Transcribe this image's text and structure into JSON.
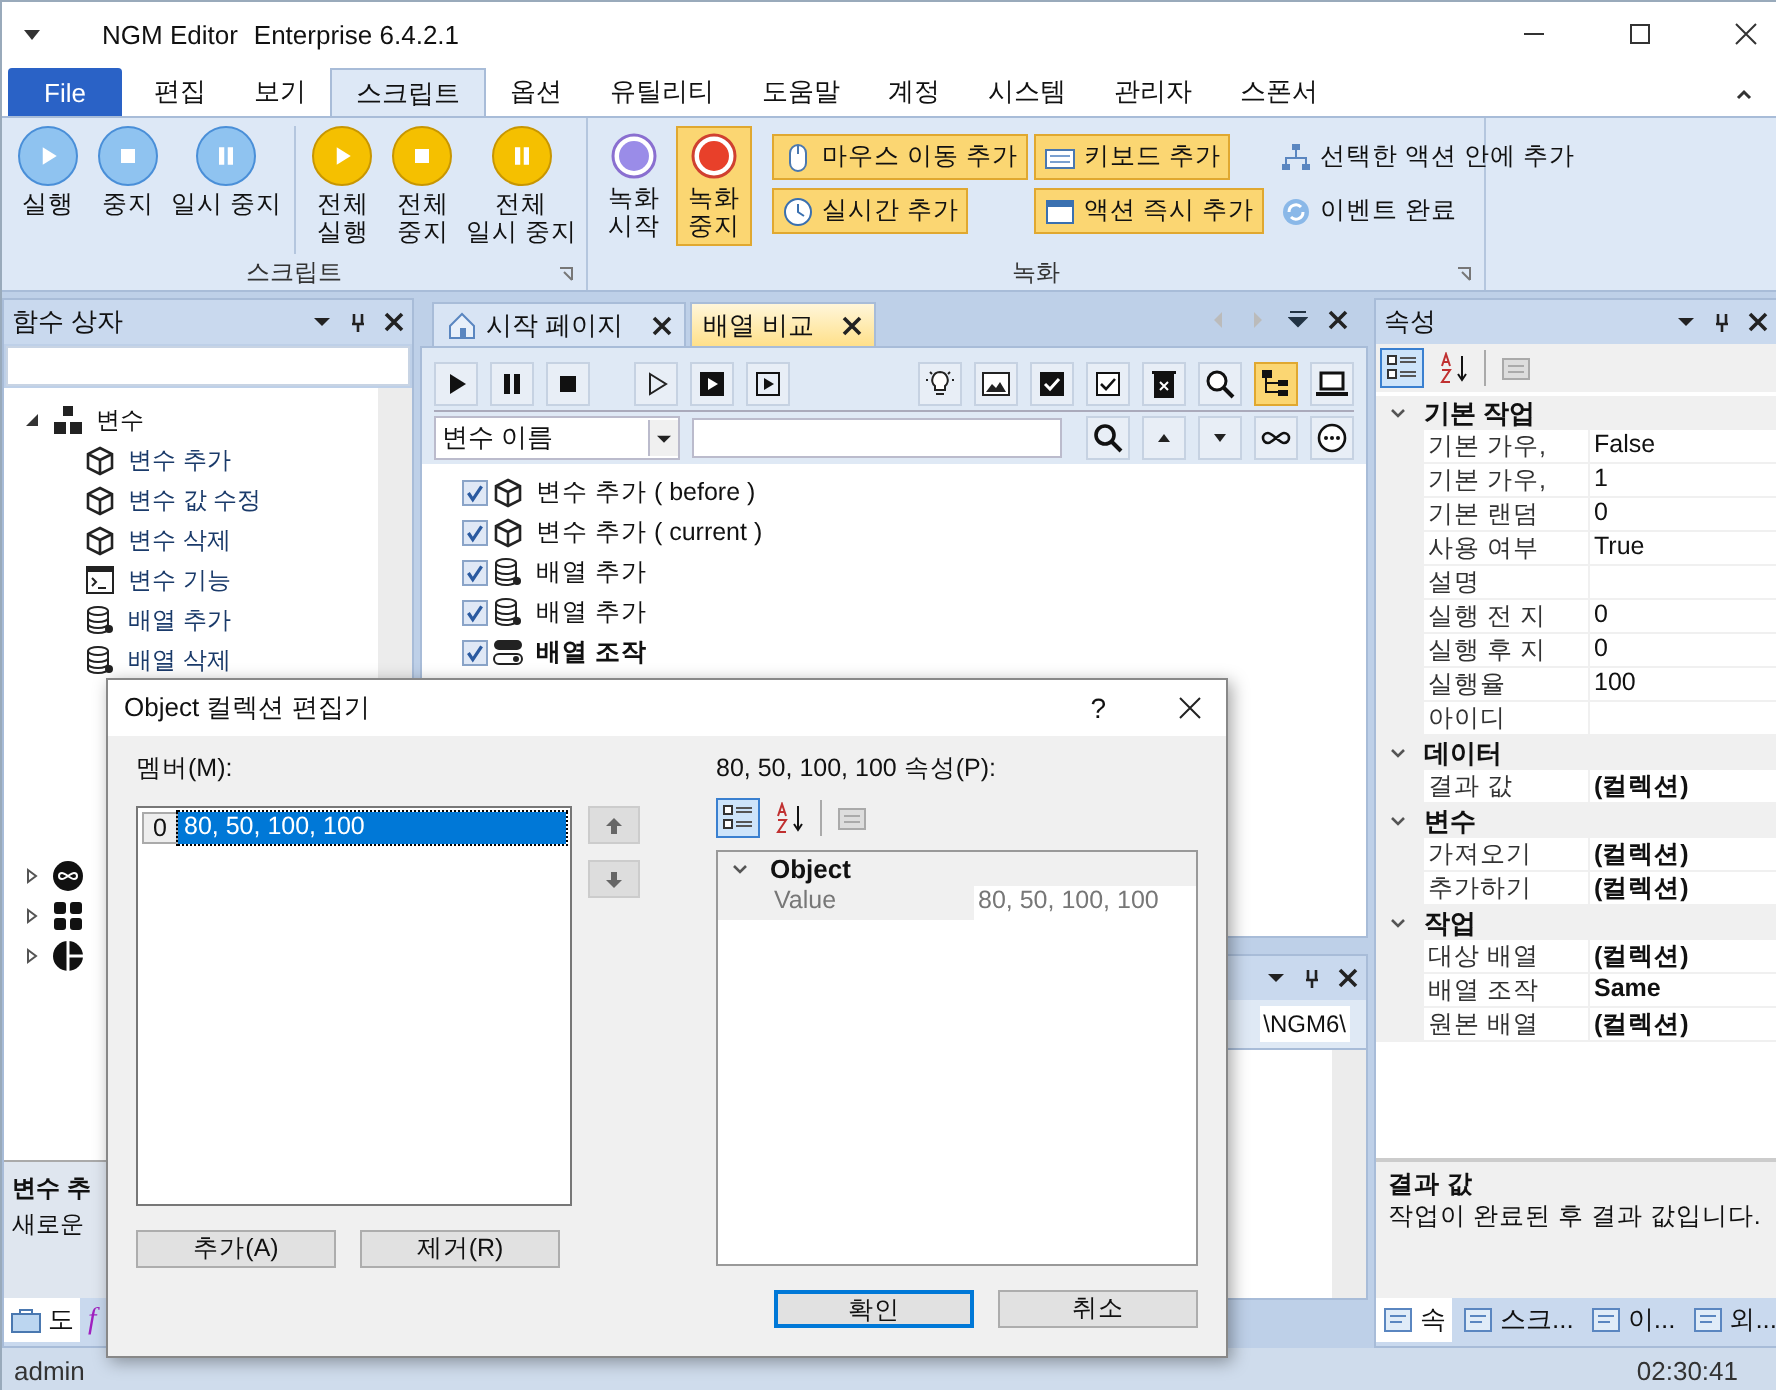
{
  "window": {
    "title": "NGM Editor",
    "edition": "Enterprise 6.4.2.1"
  },
  "ribbon_tabs": [
    {
      "label": "File",
      "kind": "file",
      "selected": false
    },
    {
      "label": "편집",
      "kind": "tab",
      "selected": false
    },
    {
      "label": "보기",
      "kind": "tab",
      "selected": false
    },
    {
      "label": "스크립트",
      "kind": "tab",
      "selected": true
    },
    {
      "label": "옵션",
      "kind": "tab",
      "selected": false
    },
    {
      "label": "유틸리티",
      "kind": "tab",
      "selected": false
    },
    {
      "label": "도움말",
      "kind": "tab",
      "selected": false
    },
    {
      "label": "계정",
      "kind": "tab",
      "selected": false
    },
    {
      "label": "시스템",
      "kind": "tab",
      "selected": false
    },
    {
      "label": "관리자",
      "kind": "tab",
      "selected": false
    },
    {
      "label": "스폰서",
      "kind": "tab",
      "selected": false
    }
  ],
  "ribbon": {
    "script_group": {
      "label": "스크립트",
      "buttons": [
        {
          "label": "실행",
          "kind": "single"
        },
        {
          "label": "중지",
          "kind": "single"
        },
        {
          "label": "일시 중지",
          "kind": "single"
        },
        {
          "label": "전체\n실행",
          "kind": "all"
        },
        {
          "label": "전체\n중지",
          "kind": "all"
        },
        {
          "label": "전체\n일시 중지",
          "kind": "all"
        }
      ]
    },
    "record_group": {
      "label": "녹화",
      "big_buttons": [
        {
          "label": "녹화\n시작",
          "selected": false
        },
        {
          "label": "녹화\n중지",
          "selected": true
        }
      ],
      "small_buttons": [
        {
          "label": "마우스 이동 추가",
          "selected": true
        },
        {
          "label": "키보드 추가",
          "selected": true
        },
        {
          "label": "선택한 액션 안에 추가",
          "selected": false
        },
        {
          "label": "실시간 추가",
          "selected": true
        },
        {
          "label": "액션 즉시 추가",
          "selected": true
        },
        {
          "label": "이벤트 완료",
          "selected": false
        }
      ]
    }
  },
  "function_box": {
    "title": "함수 상자",
    "tree": [
      {
        "label": "변수",
        "kind": "group",
        "expanded": true,
        "children": [
          {
            "label": "변수 추가",
            "kind": "variable"
          },
          {
            "label": "변수 값 수정",
            "kind": "variable"
          },
          {
            "label": "변수 삭제",
            "kind": "variable"
          },
          {
            "label": "변수 기능",
            "kind": "function"
          },
          {
            "label": "배열 추가",
            "kind": "array"
          },
          {
            "label": "배열 삭제",
            "kind": "array"
          }
        ]
      }
    ],
    "collapsed_groups": [
      {
        "kind": "loop",
        "expanded": false
      },
      {
        "kind": "calc",
        "expanded": false
      },
      {
        "kind": "chart",
        "expanded": false
      }
    ],
    "description": {
      "title": "변수 추",
      "text": "새로운"
    },
    "bottom_tabs": [
      {
        "label": "도",
        "kind": "toolbox",
        "selected": true
      },
      {
        "label": "f",
        "kind": "function",
        "selected": false
      }
    ]
  },
  "document_tabs": [
    {
      "label": "시작 페이지",
      "kind": "start",
      "selected": false
    },
    {
      "label": "배열 비교",
      "kind": "document",
      "selected": true
    }
  ],
  "doc_toolbar": {
    "tree_view_on": true
  },
  "filter": {
    "field": "변수 이름"
  },
  "actions": [
    {
      "label": "변수 추가 ( before )",
      "kind": "variable",
      "checked": true,
      "bold": false
    },
    {
      "label": "변수 추가 ( current )",
      "kind": "variable",
      "checked": true,
      "bold": false
    },
    {
      "label": "배열 추가",
      "kind": "array",
      "checked": true,
      "bold": false
    },
    {
      "label": "배열 추가",
      "kind": "array",
      "checked": true,
      "bold": false
    },
    {
      "label": "배열 조작",
      "kind": "operation",
      "checked": true,
      "bold": true
    }
  ],
  "output_panel": {
    "path": "\\NGM6\\"
  },
  "properties": {
    "title": "속성",
    "categories": [
      {
        "name": "기본 작업",
        "expanded": true,
        "rows": [
          {
            "name": "기본 가우,",
            "value": "False",
            "bold": false
          },
          {
            "name": "기본 가우,",
            "value": "1",
            "bold": false
          },
          {
            "name": "기본 랜덤",
            "value": "0",
            "bold": false
          },
          {
            "name": "사용 여부",
            "value": "True",
            "bold": false
          },
          {
            "name": "설명"
          },
          {
            "name": "실행 전 지",
            "value": "0",
            "bold": false
          },
          {
            "name": "실행 후 지",
            "value": "0",
            "bold": false
          },
          {
            "name": "실행율",
            "value": "100",
            "bold": false
          },
          {
            "name": "아이디"
          }
        ]
      },
      {
        "name": "데이터",
        "expanded": true,
        "rows": [
          {
            "name": "결과 값",
            "value": "(컬렉션)",
            "bold": true
          }
        ]
      },
      {
        "name": "변수",
        "expanded": true,
        "rows": [
          {
            "name": "가져오기",
            "value": "(컬렉션)",
            "bold": true
          },
          {
            "name": "추가하기",
            "value": "(컬렉션)",
            "bold": true
          }
        ]
      },
      {
        "name": "작업",
        "expanded": true,
        "rows": [
          {
            "name": "대상 배열",
            "value": "(컬렉션)",
            "bold": true
          },
          {
            "name": "배열 조작",
            "value": "Same",
            "bold": true
          },
          {
            "name": "원본 배열",
            "value": "(컬렉션)",
            "bold": true
          }
        ]
      }
    ],
    "description": {
      "title": "결과 값",
      "text": "작업이 완료된 후 결과 값입니다."
    },
    "bottom_tabs": [
      {
        "label": "속",
        "selected": true
      },
      {
        "label": "스크...",
        "selected": false
      },
      {
        "label": "이...",
        "selected": false
      },
      {
        "label": "외...",
        "selected": false
      }
    ]
  },
  "status_bar": {
    "user": "admin",
    "time": "02:30:41"
  },
  "dialog": {
    "title": "Object 컬렉션 편집기",
    "help": "?",
    "members_label": "멤버(M):",
    "members": [
      {
        "index": "0",
        "label": "80, 50, 100, 100",
        "selected": true
      }
    ],
    "add_button": "추가(A)",
    "remove_button": "제거(R)",
    "properties_label": "80, 50, 100, 100 속성(P):",
    "category": "Object",
    "property": {
      "name": "Value",
      "value": "80, 50, 100, 100"
    },
    "ok_button": "확인",
    "cancel_button": "취소"
  }
}
